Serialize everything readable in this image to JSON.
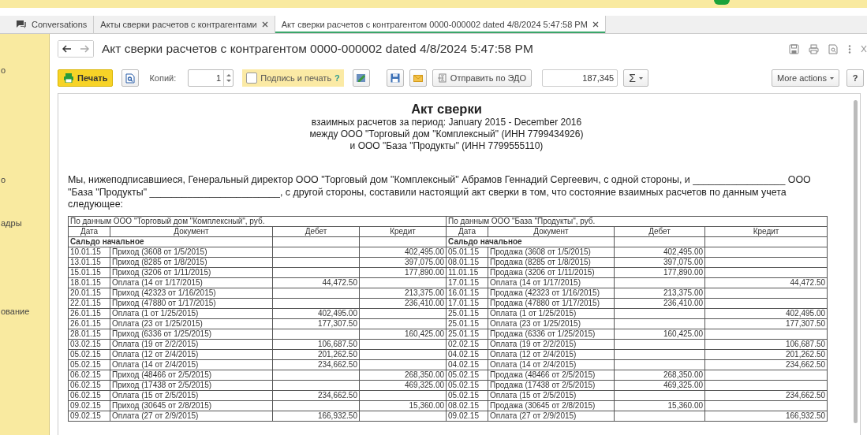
{
  "tabs": [
    {
      "label": "Conversations",
      "kind": "home",
      "selected": false
    },
    {
      "label": "Акты сверки расчетов с контрагентами",
      "kind": "closable",
      "selected": false
    },
    {
      "label": "Акт сверки расчетов с контрагентом 0000-000002 dated 4/8/2024 5:47:58 PM",
      "kind": "closable",
      "selected": true
    }
  ],
  "sidebar": {
    "items": [
      "о",
      "о",
      "адры",
      "ование"
    ]
  },
  "form": {
    "title": "Акт сверки расчетов с контрагентом 0000-000002 dated 4/8/2024 5:47:58 PM",
    "toolbar": {
      "print": "Печать",
      "copies_label": "Копий:",
      "copies": "1",
      "sign_label": "Подпись и печать",
      "sign_checked": false,
      "sign_help": "?",
      "send": "Отправить по ЭДО",
      "sum": "187,345",
      "sigma": "Σ",
      "more": "More actions",
      "help": "?"
    }
  },
  "document": {
    "title": "Акт сверки",
    "subtitle": [
      "взаимных расчетов за период: January 2015 - December 2016",
      "между ООО \"Торговый дом \"Комплексный\" (ИНН 7799434926)",
      "и ООО \"База \"Продукты\" (ИНН 7799555110)"
    ],
    "paragraph": "Мы, нижеподписавшиеся, Генеральный директор ООО \"Торговый дом \"Комплексный\" Абрамов Геннадий Сергеевич, с одной стороны, и _________________ ООО \"База \"Продукты\" ________________________, с другой стороны, составили настоящий акт сверки в том, что состояние взаимных расчетов по данным учета следующее:",
    "table": {
      "left_caption": "По данным ООО \"Торговый дом \"Комплексный\", руб.",
      "right_caption": "По данным ООО \"База \"Продукты\", руб.",
      "columns": [
        "Дата",
        "Документ",
        "Дебет",
        "Кредит",
        "Дата",
        "Документ",
        "Дебет",
        "Кредит"
      ],
      "opening_left": "Сальдо начальное",
      "opening_right": "Сальдо начальное",
      "rows": [
        {
          "left": {
            "date": "10.01.15",
            "document": "Приход (3608 от 1/5/2015)",
            "credit": "402,495.00"
          },
          "right": {
            "date": "05.01.15",
            "document": "Продажа (3608 от 1/5/2015)",
            "debit": "402,495.00"
          }
        },
        {
          "left": {
            "date": "13.01.15",
            "document": "Приход (8285 от 1/8/2015)",
            "credit": "397,075.00"
          },
          "right": {
            "date": "08.01.15",
            "document": "Продажа (8285 от 1/8/2015)",
            "debit": "397,075.00"
          }
        },
        {
          "left": {
            "date": "15.01.15",
            "document": "Приход (3206 от 1/11/2015)",
            "credit": "177,890.00"
          },
          "right": {
            "date": "11.01.15",
            "document": "Продажа (3206 от 1/11/2015)",
            "debit": "177,890.00"
          }
        },
        {
          "left": {
            "date": "18.01.15",
            "document": "Оплата (14 от 1/17/2015)",
            "debit": "44,472.50"
          },
          "right": {
            "date": "17.01.15",
            "document": "Оплата (14 от 1/17/2015)",
            "credit": "44,472.50"
          }
        },
        {
          "left": {
            "date": "20.01.15",
            "document": "Приход (42323 от 1/16/2015)",
            "credit": "213,375.00"
          },
          "right": {
            "date": "16.01.15",
            "document": "Продажа (42323 от 1/16/2015)",
            "debit": "213,375.00"
          }
        },
        {
          "left": {
            "date": "22.01.15",
            "document": "Приход (47880 от 1/17/2015)",
            "credit": "236,410.00"
          },
          "right": {
            "date": "17.01.15",
            "document": "Продажа (47880 от 1/17/2015)",
            "debit": "236,410.00"
          }
        },
        {
          "left": {
            "date": "26.01.15",
            "document": "Оплата (1 от 1/25/2015)",
            "debit": "402,495.00"
          },
          "right": {
            "date": "25.01.15",
            "document": "Оплата (1 от 1/25/2015)",
            "credit": "402,495.00"
          }
        },
        {
          "left": {
            "date": "26.01.15",
            "document": "Оплата (23 от 1/25/2015)",
            "debit": "177,307.50"
          },
          "right": {
            "date": "25.01.15",
            "document": "Оплата (23 от 1/25/2015)",
            "credit": "177,307.50"
          }
        },
        {
          "left": {
            "date": "28.01.15",
            "document": "Приход (6336 от 1/25/2015)",
            "credit": "160,425.00"
          },
          "right": {
            "date": "25.01.15",
            "document": "Продажа (6336 от 1/25/2015)",
            "debit": "160,425.00"
          }
        },
        {
          "left": {
            "date": "03.02.15",
            "document": "Оплата (19 от 2/2/2015)",
            "debit": "106,687.50"
          },
          "right": {
            "date": "02.02.15",
            "document": "Оплата (19 от 2/2/2015)",
            "credit": "106,687.50"
          }
        },
        {
          "left": {
            "date": "05.02.15",
            "document": "Оплата (12 от 2/4/2015)",
            "debit": "201,262.50"
          },
          "right": {
            "date": "04.02.15",
            "document": "Оплата (12 от 2/4/2015)",
            "credit": "201,262.50"
          }
        },
        {
          "left": {
            "date": "05.02.15",
            "document": "Оплата (14 от 2/4/2015)",
            "debit": "234,662.50"
          },
          "right": {
            "date": "04.02.15",
            "document": "Оплата (14 от 2/4/2015)",
            "credit": "234,662.50"
          }
        },
        {
          "left": {
            "date": "06.02.15",
            "document": "Приход (48466 от 2/5/2015)",
            "credit": "268,350.00"
          },
          "right": {
            "date": "05.02.15",
            "document": "Продажа (48466 от 2/5/2015)",
            "debit": "268,350.00"
          }
        },
        {
          "left": {
            "date": "06.02.15",
            "document": "Приход (17438 от 2/5/2015)",
            "credit": "469,325.00"
          },
          "right": {
            "date": "05.02.15",
            "document": "Продажа (17438 от 2/5/2015)",
            "debit": "469,325.00"
          }
        },
        {
          "left": {
            "date": "06.02.15",
            "document": "Оплата (15 от 2/5/2015)",
            "debit": "234,662.50"
          },
          "right": {
            "date": "05.02.15",
            "document": "Оплата (15 от 2/5/2015)",
            "credit": "234,662.50"
          }
        },
        {
          "left": {
            "date": "09.02.15",
            "document": "Приход (30645 от 2/8/2015)",
            "credit": "15,360.00"
          },
          "right": {
            "date": "08.02.15",
            "document": "Продажа (30645 от 2/8/2015)",
            "debit": "15,360.00"
          }
        },
        {
          "left": {
            "date": "09.02.15",
            "document": "Оплата (27 от 2/9/2015)",
            "debit": "166,932.50"
          },
          "right": {
            "date": "09.02.15",
            "document": "Оплата (27 от 2/9/2015)",
            "credit": "166,932.50"
          }
        }
      ]
    }
  }
}
